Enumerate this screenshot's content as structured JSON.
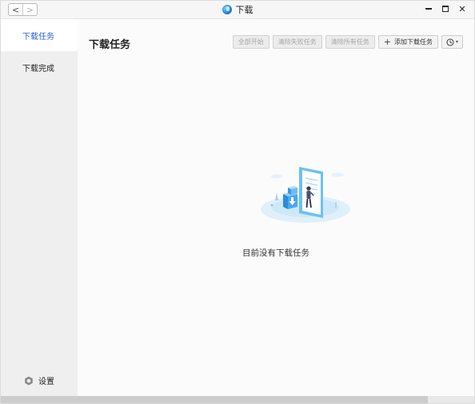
{
  "window": {
    "title": "下载",
    "nav_back": "<",
    "nav_forward": ">",
    "close_glyph": "✕"
  },
  "sidebar": {
    "items": [
      {
        "label": "下载任务",
        "active": true
      },
      {
        "label": "下载完成",
        "active": false
      }
    ],
    "settings_label": "设置"
  },
  "main": {
    "title": "下载任务",
    "empty_message": "目前没有下载任务"
  },
  "toolbar": {
    "start_all": "全部开始",
    "clear_failed": "清除失败任务",
    "clear_all": "清除所有任务",
    "add_task_plus": "+",
    "add_task": "添加下载任务",
    "speed_menu_caret": "▾"
  },
  "colors": {
    "accent": "#2a5fd0",
    "sidebar_bg": "#efefef",
    "main_bg": "#fbfbfb"
  },
  "icons": [
    "app-logo-icon",
    "back-icon",
    "forward-icon",
    "minimize-icon",
    "maximize-icon",
    "close-icon",
    "plus-icon",
    "clock-icon",
    "settings-gear-icon",
    "empty-download-illustration"
  ]
}
